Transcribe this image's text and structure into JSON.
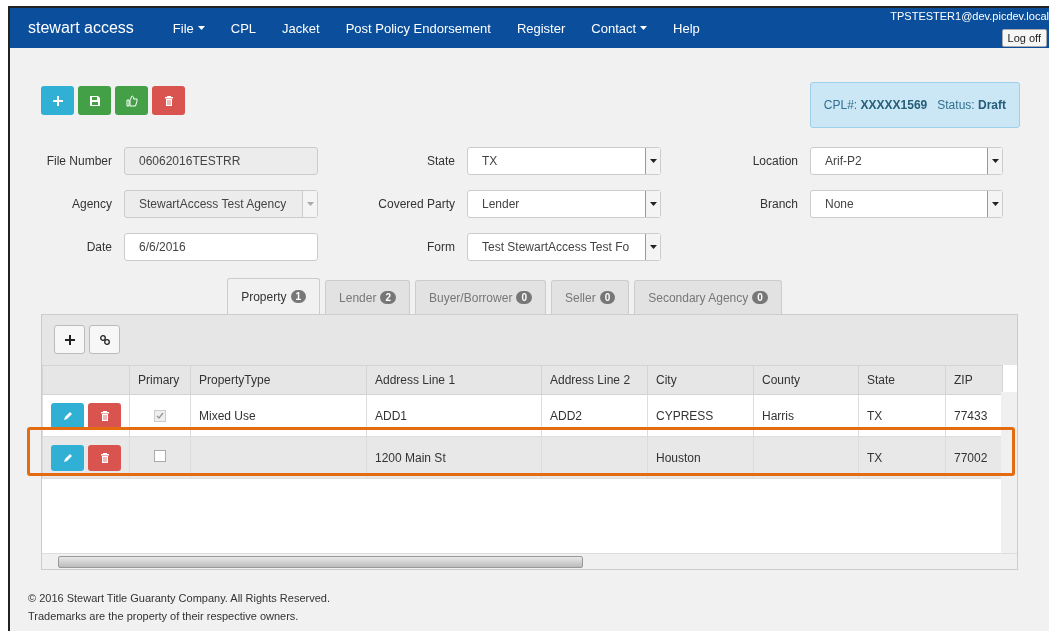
{
  "navbar": {
    "brand": "stewart access",
    "items": [
      {
        "label": "File",
        "dropdown": true
      },
      {
        "label": "CPL",
        "dropdown": false
      },
      {
        "label": "Jacket",
        "dropdown": false
      },
      {
        "label": "Post Policy Endorsement",
        "dropdown": false
      },
      {
        "label": "Register",
        "dropdown": false
      },
      {
        "label": "Contact",
        "dropdown": true
      },
      {
        "label": "Help",
        "dropdown": false
      }
    ],
    "user": "TPSTESTER1@dev.picdev.local",
    "logoff": "Log off"
  },
  "toolbar": [
    {
      "kind": "add"
    },
    {
      "kind": "save"
    },
    {
      "kind": "approve"
    },
    {
      "kind": "delete"
    }
  ],
  "cpl_box": {
    "cpl_label": "CPL#:",
    "cpl_value": "XXXXX1569",
    "status_label": "Status:",
    "status_value": "Draft"
  },
  "form": [
    [
      {
        "label": "File Number",
        "value": "06062016TESTRR",
        "kind": "readonly"
      },
      {
        "label": "State",
        "value": "TX",
        "kind": "select"
      },
      {
        "label": "Location",
        "value": "Arif-P2",
        "kind": "select"
      }
    ],
    [
      {
        "label": "Agency",
        "value": "StewartAccess Test Agency",
        "kind": "disabled-select"
      },
      {
        "label": "Covered Party",
        "value": "Lender",
        "kind": "select"
      },
      {
        "label": "Branch",
        "value": "None",
        "kind": "select"
      }
    ],
    [
      {
        "label": "Date",
        "value": "6/6/2016",
        "kind": "text"
      },
      {
        "label": "Form",
        "value": "Test StewartAccess Test Fo",
        "kind": "select"
      }
    ]
  ],
  "tabs": [
    {
      "label": "Property",
      "count": "1",
      "selected": true
    },
    {
      "label": "Lender",
      "count": "2",
      "selected": false
    },
    {
      "label": "Buyer/Borrower",
      "count": "0",
      "selected": false
    },
    {
      "label": "Seller",
      "count": "0",
      "selected": false
    },
    {
      "label": "Secondary Agency",
      "count": "0",
      "selected": false
    }
  ],
  "grid_toolbar": [
    {
      "kind": "add"
    },
    {
      "kind": "link"
    }
  ],
  "table": {
    "columns": [
      "",
      "Primary",
      "PropertyType",
      "Address Line 1",
      "Address Line 2",
      "City",
      "County",
      "State",
      "ZIP"
    ],
    "rows": [
      {
        "primary": true,
        "primary_disabled": true,
        "selected": false,
        "highlighted": false,
        "cells": [
          "",
          "",
          "Mixed Use",
          "ADD1",
          "ADD2",
          "CYPRESS",
          "Harris",
          "TX",
          "77433"
        ]
      },
      {
        "primary": false,
        "primary_disabled": false,
        "selected": true,
        "highlighted": true,
        "cells": [
          "",
          "",
          "",
          "1200 Main St",
          "",
          "Houston",
          "",
          "TX",
          "77002"
        ]
      }
    ]
  },
  "footer": [
    "© 2016 Stewart Title Guaranty Company. All Rights Reserved.",
    "Trademarks are the property of their respective owners."
  ]
}
